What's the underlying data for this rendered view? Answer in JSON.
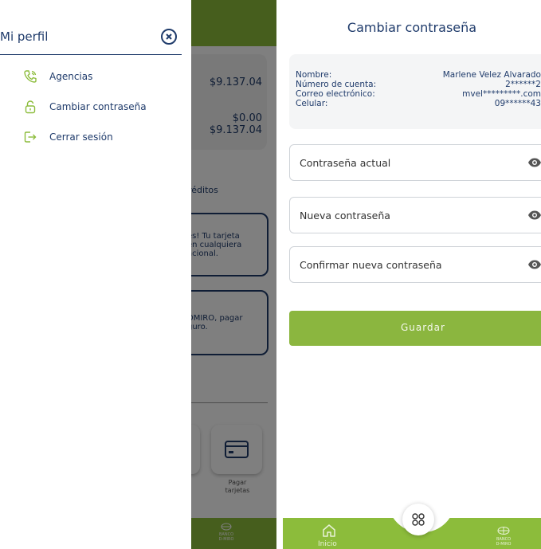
{
  "background_app": {
    "amounts": [
      "$9.137.04",
      "$0.00",
      "$9.137.04"
    ],
    "section_label": "réditos",
    "promo_1": [
      "es! Tu tarjeta",
      "en cualquiera",
      "acional."
    ],
    "promo_2": [
      "DMIRO, pagar",
      "guro."
    ],
    "tile_label_1": "Pagar",
    "tile_label_2": "tarjetas",
    "bank_mini_1": "BANCO",
    "bank_mini_2": "D-MIRO"
  },
  "drawer": {
    "title": "Mi perfil",
    "items": [
      {
        "label": "Agencias",
        "icon": "phone-icon"
      },
      {
        "label": "Cambiar contraseña",
        "icon": "lock-icon"
      },
      {
        "label": "Cerrar sesión",
        "icon": "logout-icon"
      }
    ]
  },
  "change_password": {
    "title": "Cambiar contraseña",
    "info": [
      {
        "label": "Nombre:",
        "value": "Marlene Velez Alvarado"
      },
      {
        "label": "Número de cuenta:",
        "value": "2******2"
      },
      {
        "label": "Correo electrónico:",
        "value": "mvel*********.com"
      },
      {
        "label": "Celular:",
        "value": "09******43"
      }
    ],
    "fields": [
      {
        "placeholder": "Contraseña actual"
      },
      {
        "placeholder": "Nueva contraseña"
      },
      {
        "placeholder": "Confirmar nueva contraseña"
      }
    ],
    "save_label": "Guardar"
  },
  "bottom_nav": {
    "home_label": "Inicio",
    "bank_1": "BANCO",
    "bank_2": "D-MIRO"
  },
  "colors": {
    "brand_green": "#8cbc3b",
    "navy": "#1f3b6b"
  }
}
